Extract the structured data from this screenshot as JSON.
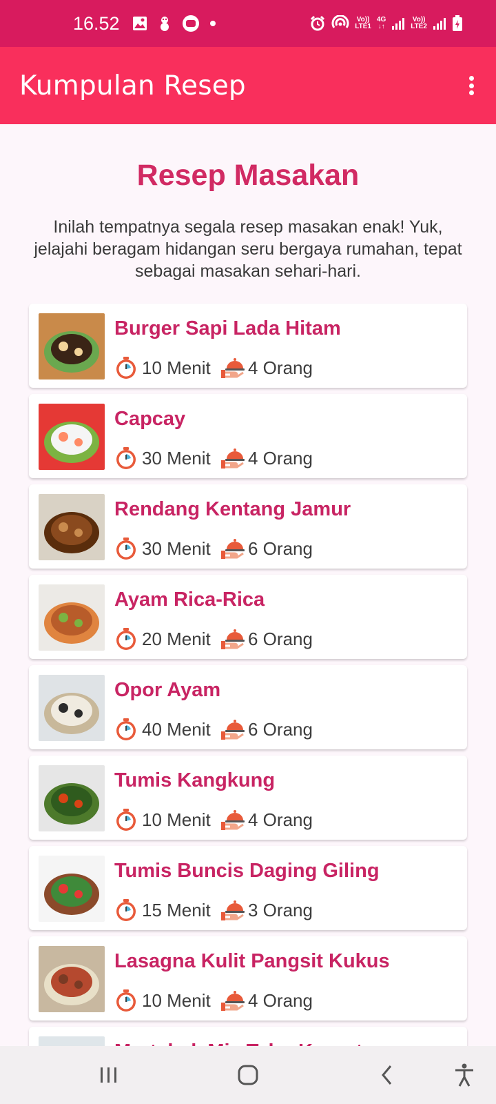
{
  "status_bar": {
    "time": "16.52",
    "sim1_volte": "Vo))",
    "sim1_network": "LTE1",
    "net_type": "4G",
    "sim2_volte": "Vo))",
    "sim2_network": "LTE2",
    "left_icons": [
      "image-icon",
      "app-notification-icon",
      "chat-icon",
      "dot-icon"
    ],
    "right_icons": [
      "alarm-icon",
      "hotspot-icon",
      "signal-icon",
      "battery-icon"
    ]
  },
  "app_bar": {
    "title": "Kumpulan Resep",
    "menu_icon": "more-vertical-icon"
  },
  "main": {
    "heading": "Resep Masakan",
    "intro": "Inilah tempatnya segala resep masakan enak! Yuk, jelajahi beragam hidangan seru bergaya rumahan, tepat sebagai masakan sehari-hari.",
    "recipes": [
      {
        "name": "Burger Sapi Lada Hitam",
        "time": "10 Menit",
        "servings": "4 Orang"
      },
      {
        "name": "Capcay",
        "time": "30 Menit",
        "servings": "4 Orang"
      },
      {
        "name": "Rendang Kentang Jamur",
        "time": "30 Menit",
        "servings": "6 Orang"
      },
      {
        "name": "Ayam Rica-Rica",
        "time": "20 Menit",
        "servings": "6 Orang"
      },
      {
        "name": "Opor Ayam",
        "time": "40 Menit",
        "servings": "6 Orang"
      },
      {
        "name": "Tumis Kangkung",
        "time": "10 Menit",
        "servings": "4 Orang"
      },
      {
        "name": "Tumis Buncis Daging Giling",
        "time": "15 Menit",
        "servings": "3 Orang"
      },
      {
        "name": "Lasagna Kulit Pangsit Kukus",
        "time": "10 Menit",
        "servings": "4 Orang"
      },
      {
        "name": "Martabak Mie Tahu Kornet",
        "time": "",
        "servings": ""
      }
    ]
  },
  "nav_bar": {
    "icons": [
      "recent-apps-icon",
      "home-icon",
      "back-icon",
      "accessibility-icon"
    ]
  },
  "colors": {
    "status_bar": "#d81b5e",
    "app_bar": "#f92f5c",
    "heading": "#d12a63",
    "recipe_name": "#c82463",
    "background": "#fdf6fb"
  }
}
